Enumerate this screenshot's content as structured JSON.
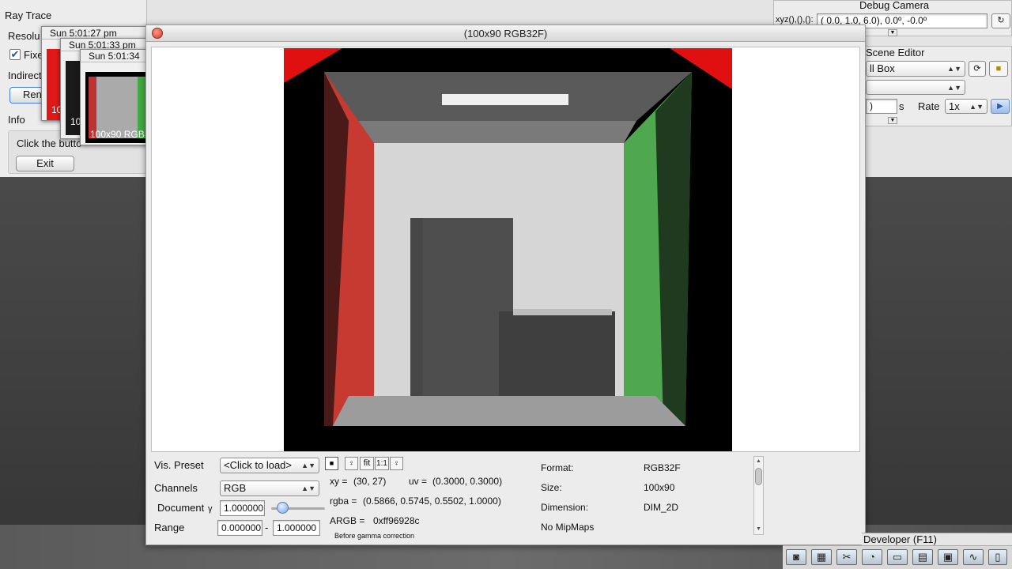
{
  "raytrace": {
    "title": "Ray Trace",
    "resolution_label": "Resolu",
    "fixed_label": "Fixe",
    "fixed_checked": true,
    "indirect_label": "Indirect",
    "render_label": "Ren",
    "info_label": "Info",
    "info_text": "Click the butto",
    "exit_label": "Exit"
  },
  "snapshots": [
    {
      "title": "Sun 5:01:27 pm",
      "caption": "10"
    },
    {
      "title": "Sun 5:01:33 pm",
      "caption": "10"
    },
    {
      "title": "Sun 5:01:34",
      "caption": "100x90 RGB"
    }
  ],
  "debug_camera": {
    "title": "Debug Camera",
    "xyz_label": "xyz(),(),():",
    "value": "(  0.0,   1.0,   6.0),   0.0º,  -0.0º"
  },
  "scene_editor": {
    "title": "Scene Editor",
    "scene_value": "ll Box",
    "second_value": "",
    "time_value": ")",
    "time_unit": "s",
    "rate_label": "Rate",
    "rate_value": "1x"
  },
  "developer_label": "Developer (F11)",
  "texture_window": {
    "title": "(100x90 RGB32F)",
    "vis_preset_label": "Vis. Preset",
    "vis_preset_value": "<Click to load>",
    "channels_label": "Channels",
    "channels_value": "RGB",
    "document_label": "Document",
    "gamma_symbol": "γ",
    "gamma_value": "1.000000",
    "gamma_slider_fraction": 0.2,
    "range_label": "Range",
    "range_min": "0.000000",
    "range_sep": "-",
    "range_max": "1.000000",
    "fit_label": "fit",
    "one_to_one_label": "1:1",
    "xy_label": "xy =",
    "xy_value": "(30, 27)",
    "uv_label": "uv =",
    "uv_value": "(0.3000, 0.3000)",
    "rgba_label": "rgba =",
    "rgba_value": "(0.5866, 0.5745, 0.5502, 1.0000)",
    "argb_label": "ARGB =",
    "argb_value": "0xff96928c",
    "gamma_note": "Before gamma correction",
    "format_label": "Format:",
    "format_value": "RGB32F",
    "size_label": "Size:",
    "size_value": "100x90",
    "dimension_label": "Dimension:",
    "dimension_value": "DIM_2D",
    "mipmaps_label": "No MipMaps"
  },
  "dock_icons": [
    "camera-icon",
    "clapper-icon",
    "tools-icon",
    "gauge-icon",
    "note-icon",
    "console-icon",
    "windows-icon",
    "profiler-icon",
    "document-icon"
  ],
  "colors": {
    "red_wall": "#d8473d",
    "green_wall": "#52b252",
    "panel": "#ececec"
  }
}
